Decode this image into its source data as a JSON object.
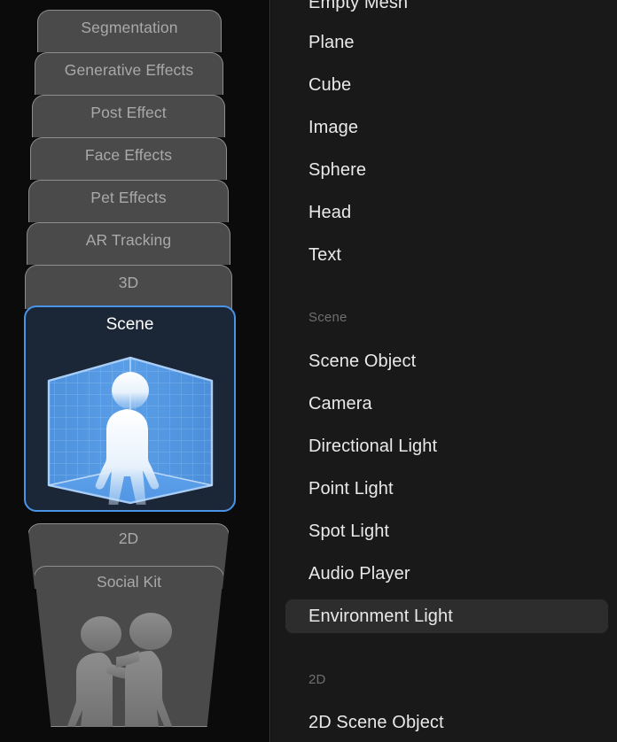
{
  "sidebar": {
    "tabs": [
      {
        "label": "Segmentation",
        "state": "normal"
      },
      {
        "label": "Generative Effects",
        "state": "normal"
      },
      {
        "label": "Post Effect",
        "state": "normal"
      },
      {
        "label": "Face Effects",
        "state": "normal"
      },
      {
        "label": "Pet Effects",
        "state": "normal"
      },
      {
        "label": "AR Tracking",
        "state": "normal"
      },
      {
        "label": "3D",
        "state": "normal"
      }
    ],
    "selected_card": {
      "label": "Scene",
      "icon": "scene-room-person-icon",
      "selected": true,
      "border_color": "#4a94e8",
      "background_color": "#1b2637"
    },
    "bottom_tabs": [
      {
        "label": "2D",
        "icon": ""
      },
      {
        "label": "Social Kit",
        "icon": "two-people-icon"
      }
    ],
    "colors": {
      "tab_bg": "#4a4a4a",
      "tab_border": "#8e8e8e",
      "tab_text": "#a9a9a9",
      "rail_bg": "#0b0b0b"
    }
  },
  "list_panel": {
    "background_color": "#191919",
    "selected_row_color": "#2d2d2d",
    "rows": [
      {
        "label": "Empty Mesh",
        "type": "item",
        "selected": false,
        "clipped_top": true
      },
      {
        "label": "Plane",
        "type": "item",
        "selected": false
      },
      {
        "label": "Cube",
        "type": "item",
        "selected": false
      },
      {
        "label": "Image",
        "type": "item",
        "selected": false
      },
      {
        "label": "Sphere",
        "type": "item",
        "selected": false
      },
      {
        "label": "Head",
        "type": "item",
        "selected": false
      },
      {
        "label": "Text",
        "type": "item",
        "selected": false
      },
      {
        "label": "Scene",
        "type": "section"
      },
      {
        "label": "Scene Object",
        "type": "item",
        "selected": false
      },
      {
        "label": "Camera",
        "type": "item",
        "selected": false
      },
      {
        "label": "Directional Light",
        "type": "item",
        "selected": false
      },
      {
        "label": "Point Light",
        "type": "item",
        "selected": false
      },
      {
        "label": "Spot Light",
        "type": "item",
        "selected": false
      },
      {
        "label": "Audio Player",
        "type": "item",
        "selected": false
      },
      {
        "label": "Environment Light",
        "type": "item",
        "selected": true
      },
      {
        "label": "2D",
        "type": "section"
      },
      {
        "label": "2D Scene Object",
        "type": "item",
        "selected": false
      }
    ]
  }
}
